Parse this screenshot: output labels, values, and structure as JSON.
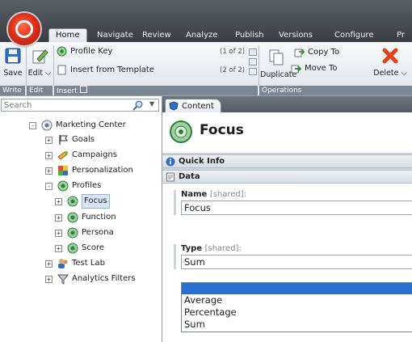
{
  "topbar": {
    "tabs": [
      "Home",
      "Navigate",
      "Review",
      "Analyze",
      "Publish",
      "Versions",
      "Configure",
      "Pr"
    ],
    "active_tab": "Home"
  },
  "ribbon": {
    "save_label": "Save",
    "edit_label": "Edit",
    "edit_chevron": "⌵",
    "profile_key_label": "Profile Key",
    "profile_key_count": "(1 of 2)",
    "insert_template_label": "Insert from Template",
    "insert_template_count": "(2 of 2)",
    "duplicate_label": "Duplicate",
    "copy_to_label": "Copy To",
    "move_to_label": "Move To",
    "delete_label": "Delete",
    "groups": {
      "write": "Write",
      "edit": "Edit",
      "insert": "Insert",
      "operations": "Operations"
    }
  },
  "search": {
    "placeholder": "Search"
  },
  "tree": {
    "root": "Marketing Center",
    "items": [
      {
        "label": "Goals"
      },
      {
        "label": "Campaigns"
      },
      {
        "label": "Personalization"
      },
      {
        "label": "Profiles"
      },
      {
        "label": "Focus"
      },
      {
        "label": "Function"
      },
      {
        "label": "Persona"
      },
      {
        "label": "Score"
      },
      {
        "label": "Test Lab"
      },
      {
        "label": "Analytics Filters"
      }
    ]
  },
  "editor": {
    "tab_label": "Content",
    "item_title": "Focus",
    "quick_info_label": "Quick Info",
    "data_label": "Data",
    "name_field": {
      "label": "Name",
      "shared": "[shared]:",
      "value": "Focus"
    },
    "type_field": {
      "label": "Type",
      "shared": "[shared]:",
      "value": "Sum"
    },
    "dropdown_options": [
      "Average",
      "Percentage",
      "Sum"
    ]
  },
  "colors": {
    "topbar": "#3a3e44",
    "ribbon_group_label": "#7b8695",
    "selection": "#2a6fd0"
  }
}
